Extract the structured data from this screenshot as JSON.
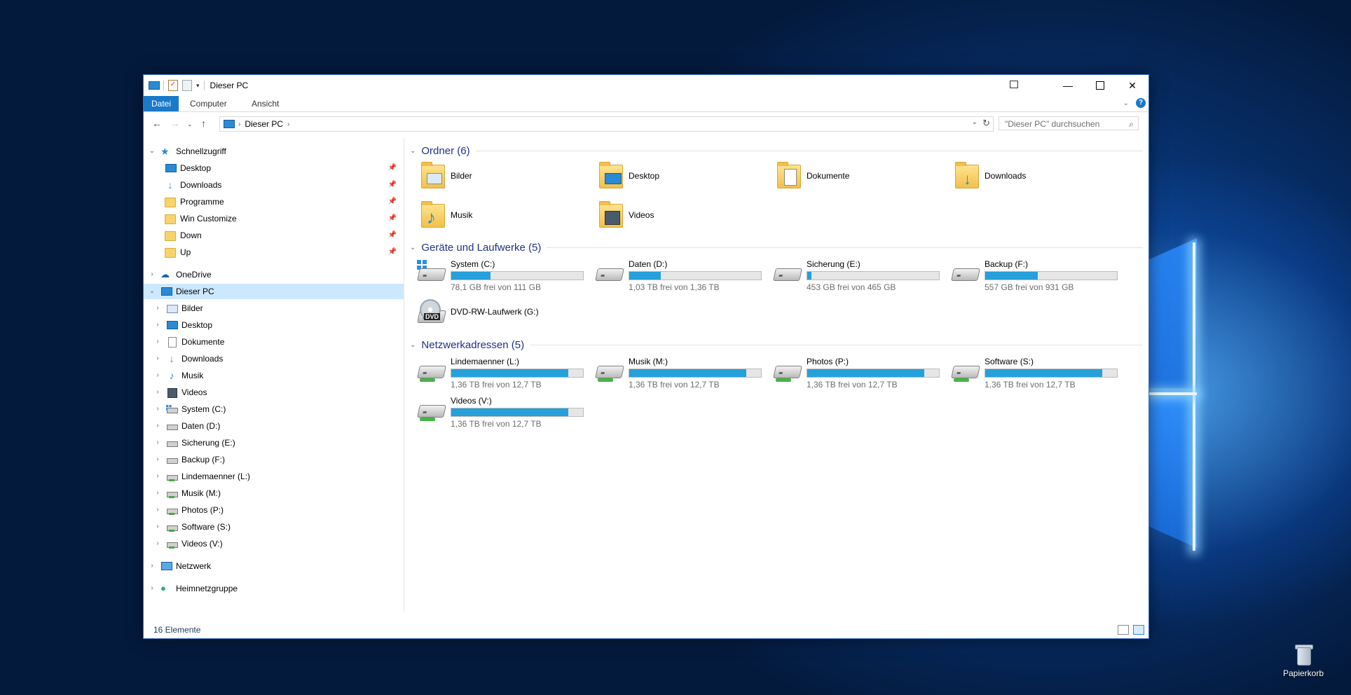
{
  "window": {
    "title": "Dieser PC",
    "tabs": [
      "Datei",
      "Computer",
      "Ansicht"
    ],
    "help": "?"
  },
  "address": {
    "path": [
      "Dieser PC"
    ],
    "search_placeholder": "\"Dieser PC\" durchsuchen"
  },
  "navpane": {
    "quick_access": "Schnellzugriff",
    "pinned": [
      "Desktop",
      "Downloads",
      "Programme",
      "Win Customize",
      "Down",
      "Up"
    ],
    "onedrive": "OneDrive",
    "this_pc": "Dieser PC",
    "this_pc_children": [
      "Bilder",
      "Desktop",
      "Dokumente",
      "Downloads",
      "Musik",
      "Videos",
      "System (C:)",
      "Daten (D:)",
      "Sicherung (E:)",
      "Backup (F:)",
      "Lindemaenner (L:)",
      "Musik (M:)",
      "Photos (P:)",
      "Software (S:)",
      "Videos (V:)"
    ],
    "network": "Netzwerk",
    "homegroup": "Heimnetzgruppe"
  },
  "groups": {
    "folders_title": "Ordner (6)",
    "drives_title": "Geräte und Laufwerke (5)",
    "network_title": "Netzwerkadressen (5)"
  },
  "folders": [
    {
      "name": "Bilder"
    },
    {
      "name": "Desktop"
    },
    {
      "name": "Dokumente"
    },
    {
      "name": "Downloads"
    },
    {
      "name": "Musik"
    },
    {
      "name": "Videos"
    }
  ],
  "drives": [
    {
      "name": "System (C:)",
      "free": "78,1 GB frei von 111 GB",
      "used_fraction": 0.3
    },
    {
      "name": "Daten (D:)",
      "free": "1,03 TB frei von 1,36 TB",
      "used_fraction": 0.24
    },
    {
      "name": "Sicherung (E:)",
      "free": "453 GB frei von 465 GB",
      "used_fraction": 0.03
    },
    {
      "name": "Backup (F:)",
      "free": "557 GB frei von 931 GB",
      "used_fraction": 0.4
    },
    {
      "name": "DVD-RW-Laufwerk (G:)"
    }
  ],
  "network_drives": [
    {
      "name": "Lindemaenner (L:)",
      "free": "1,36 TB frei von 12,7 TB",
      "used_fraction": 0.89
    },
    {
      "name": "Musik (M:)",
      "free": "1,36 TB frei von 12,7 TB",
      "used_fraction": 0.89
    },
    {
      "name": "Photos (P:)",
      "free": "1,36 TB frei von 12,7 TB",
      "used_fraction": 0.89
    },
    {
      "name": "Software (S:)",
      "free": "1,36 TB frei von 12,7 TB",
      "used_fraction": 0.89
    },
    {
      "name": "Videos (V:)",
      "free": "1,36 TB frei von 12,7 TB",
      "used_fraction": 0.89
    }
  ],
  "status": {
    "count": "16 Elemente"
  },
  "desktop": {
    "recycle_bin": "Papierkorb"
  },
  "colors": {
    "accent": "#1979ca",
    "bar_fill": "#26a0da",
    "group_header": "#1e3287",
    "selection": "#cce8ff"
  }
}
